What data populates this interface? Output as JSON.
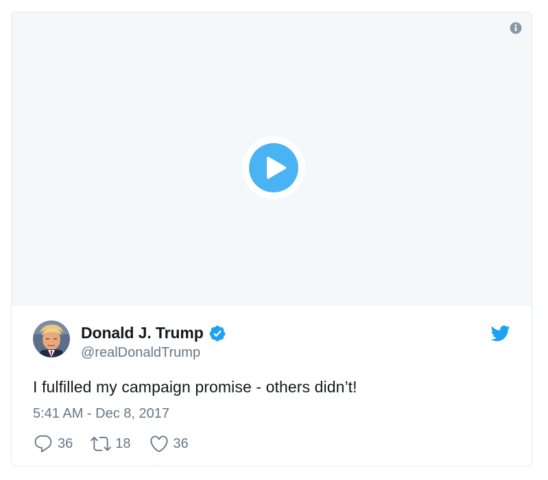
{
  "colors": {
    "accent": "#1da1f2",
    "play_button": "#4ab3f4",
    "media_background": "#f5f8fa",
    "text_primary": "#14171a",
    "text_secondary": "#657786",
    "border": "#e1e8ed"
  },
  "media": {
    "info_icon": "info-icon",
    "play_icon": "play-icon"
  },
  "author": {
    "name": "Donald J. Trump",
    "handle": "@realDonaldTrump",
    "verified": true,
    "avatar_icon": "avatar"
  },
  "tweet": {
    "text": "I fulfilled my campaign promise - others didn’t!",
    "timestamp": "5:41 AM - Dec 8, 2017"
  },
  "actions": {
    "replies": "36",
    "retweets": "18",
    "likes": "36"
  }
}
